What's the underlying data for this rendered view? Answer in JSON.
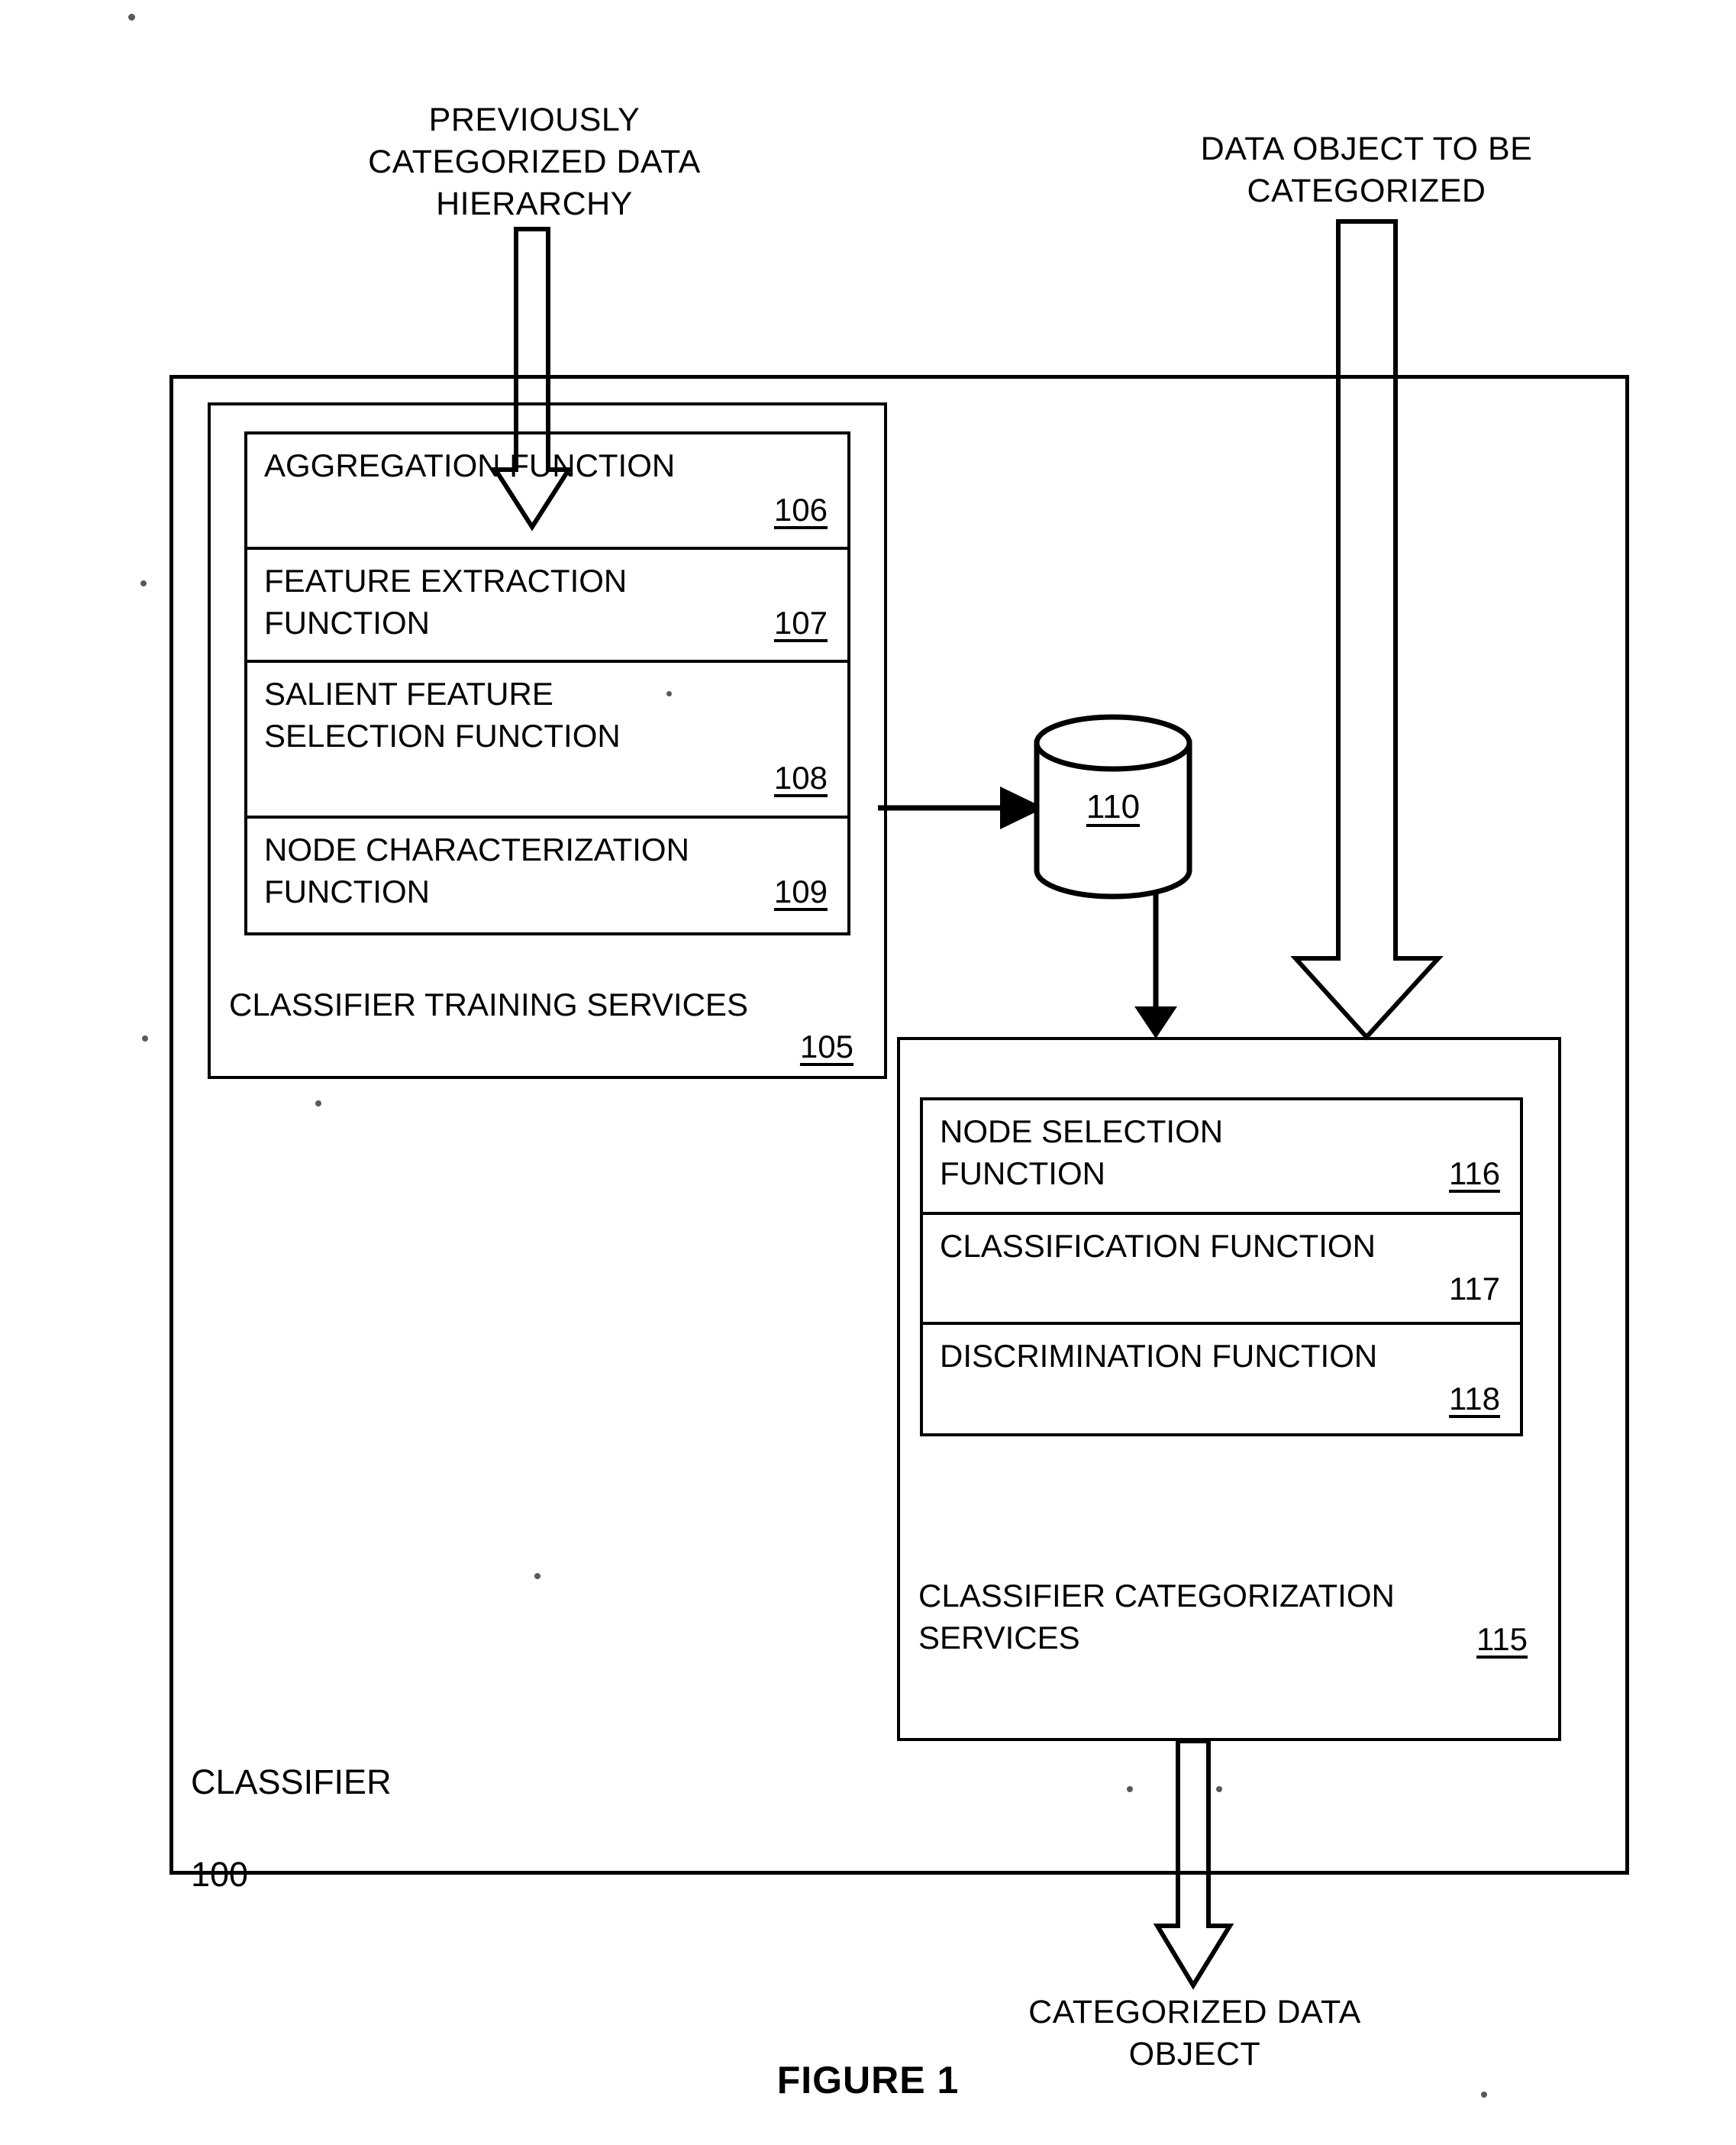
{
  "figure": {
    "caption": "FIGURE 1"
  },
  "inputs": {
    "left_arrow_label": "PREVIOUSLY\nCATEGORIZED DATA\nHIERARCHY",
    "right_arrow_label": "DATA OBJECT TO BE\nCATEGORIZED"
  },
  "outputs": {
    "bottom_arrow_label": "CATEGORIZED DATA\nOBJECT"
  },
  "classifier": {
    "name": "CLASSIFIER",
    "ref": "100"
  },
  "training_services": {
    "name": "CLASSIFIER TRAINING SERVICES",
    "ref": "105",
    "functions": [
      {
        "label": "AGGREGATION FUNCTION",
        "ref": "106",
        "underline": true,
        "num_row": 2
      },
      {
        "label": "FEATURE EXTRACTION\nFUNCTION",
        "ref": "107",
        "underline": true,
        "num_row": 2
      },
      {
        "label": "SALIENT FEATURE\nSELECTION FUNCTION",
        "ref": "108",
        "underline": true,
        "num_row": 3
      },
      {
        "label": "NODE CHARACTERIZATION\nFUNCTION",
        "ref": "109",
        "underline": true,
        "num_row": 2
      }
    ]
  },
  "datastore": {
    "ref": "110",
    "shape": "database-cylinder-icon"
  },
  "categorization_services": {
    "name": "CLASSIFIER CATEGORIZATION\nSERVICES",
    "ref": "115",
    "functions": [
      {
        "label": "NODE SELECTION\nFUNCTION",
        "ref": "116",
        "underline": true,
        "num_row": 2
      },
      {
        "label": "CLASSIFICATION FUNCTION",
        "ref": "117",
        "underline": false,
        "num_row": 2
      },
      {
        "label": "DISCRIMINATION FUNCTION",
        "ref": "118",
        "underline": true,
        "num_row": 2
      }
    ]
  },
  "colors": {
    "ink": "#000000",
    "paper": "#ffffff"
  }
}
